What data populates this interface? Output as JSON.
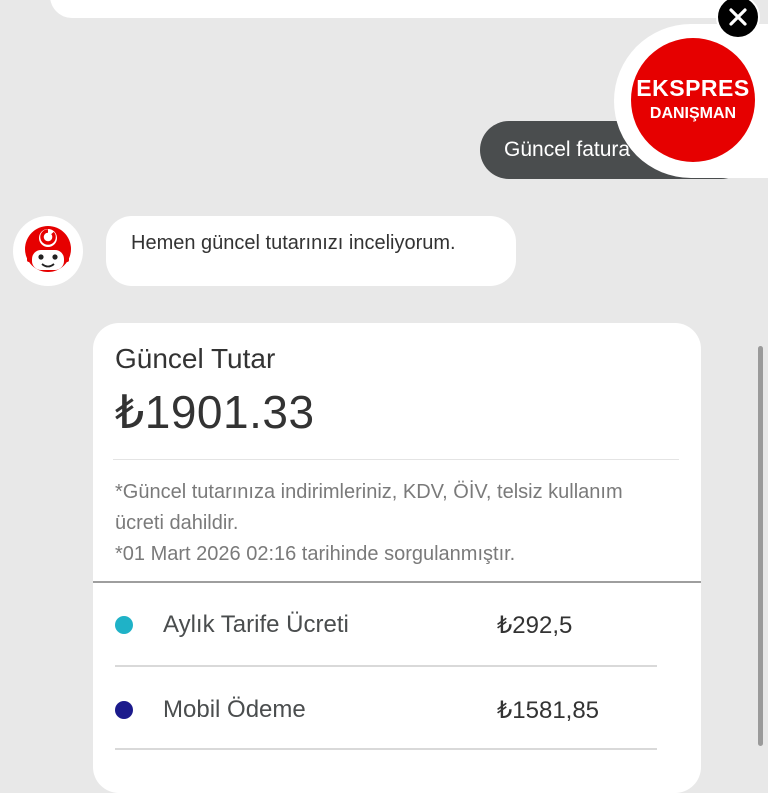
{
  "user_message": {
    "text": "Güncel fatura"
  },
  "ekspres": {
    "title": "EKSPRES",
    "subtitle": "DANIŞMAN"
  },
  "bot_message": {
    "text": "Hemen güncel tutarınızı inceliyorum."
  },
  "bill": {
    "title": "Güncel Tutar",
    "amount": "₺1901.33",
    "note_line1": "*Güncel tutarınıza indirimleriniz, KDV, ÖİV, telsiz kullanım ücreti dahildir.",
    "note_line2": "*01 Mart 2026 02:16 tarihinde sorgulanmıştır.",
    "items": [
      {
        "label": "Aylık Tarife Ücreti",
        "value": "₺292,5",
        "color": "#1fb2c7"
      },
      {
        "label": "Mobil Ödeme",
        "value": "₺1581,85",
        "color": "#1b1a8c"
      }
    ]
  },
  "colors": {
    "brand_red": "#e60000",
    "user_bubble": "#4a4d4e",
    "background": "#e8e8e8"
  },
  "icons": {
    "close": "close-icon",
    "avatar": "vodafone-robot-avatar-icon"
  }
}
